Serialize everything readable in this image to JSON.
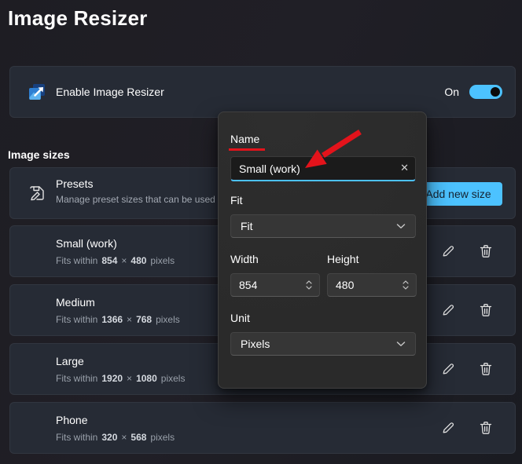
{
  "page": {
    "title": "Image Resizer"
  },
  "enable_card": {
    "label": "Enable Image Resizer",
    "toggle_state": "On"
  },
  "sections": {
    "image_sizes": "Image sizes"
  },
  "presets_card": {
    "title": "Presets",
    "subtitle": "Manage preset sizes that can be used i"
  },
  "add_button": {
    "label": "Add new size"
  },
  "sizes": {
    "fits_prefix": "Fits within",
    "times": "×",
    "unit_suffix": "pixels",
    "items": [
      {
        "name": "Small (work)",
        "width": "854",
        "height": "480"
      },
      {
        "name": "Medium",
        "width": "1366",
        "height": "768"
      },
      {
        "name": "Large",
        "width": "1920",
        "height": "1080"
      },
      {
        "name": "Phone",
        "width": "320",
        "height": "568"
      }
    ]
  },
  "popup": {
    "name_label": "Name",
    "name_value": "Small (work)",
    "clear_glyph": "✕",
    "fit_label": "Fit",
    "fit_value": "Fit",
    "width_label": "Width",
    "width_value": "854",
    "height_label": "Height",
    "height_value": "480",
    "unit_label": "Unit",
    "unit_value": "Pixels"
  },
  "colors": {
    "accent": "#4cc2ff",
    "annotation_red": "#e3131b",
    "card_bg": "#262b35",
    "popup_bg": "#2b2b2b"
  }
}
